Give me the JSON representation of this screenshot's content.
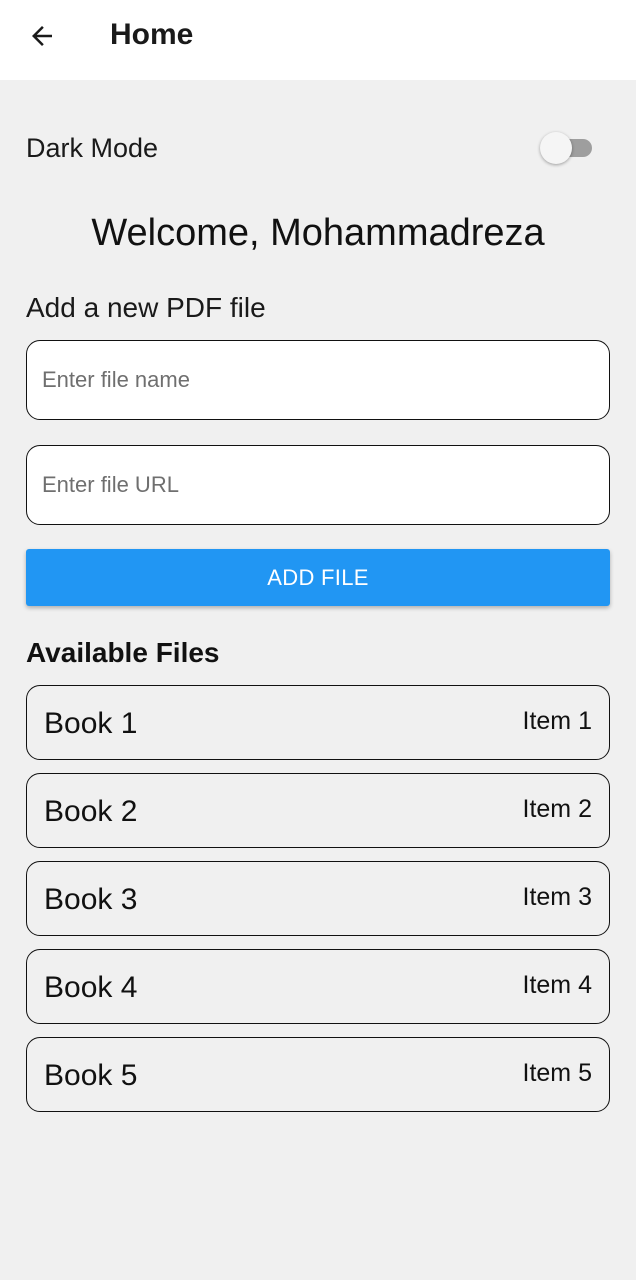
{
  "appbar": {
    "title": "Home",
    "back_icon": "arrow-left-icon"
  },
  "settings": {
    "dark_mode_label": "Dark Mode",
    "dark_mode_on": false
  },
  "welcome": "Welcome, Mohammadreza",
  "add_section": {
    "label": "Add a new PDF file",
    "name_input": {
      "placeholder": "Enter file name",
      "value": ""
    },
    "url_input": {
      "placeholder": "Enter file URL",
      "value": ""
    },
    "button_label": "ADD FILE"
  },
  "files": {
    "heading": "Available Files",
    "items": [
      {
        "title": "Book 1",
        "trailing": "Item 1"
      },
      {
        "title": "Book 2",
        "trailing": "Item 2"
      },
      {
        "title": "Book 3",
        "trailing": "Item 3"
      },
      {
        "title": "Book 4",
        "trailing": "Item 4"
      },
      {
        "title": "Book 5",
        "trailing": "Item 5"
      }
    ]
  },
  "colors": {
    "primary": "#2196f3",
    "background": "#f0f0f0",
    "appbar": "#ffffff"
  }
}
